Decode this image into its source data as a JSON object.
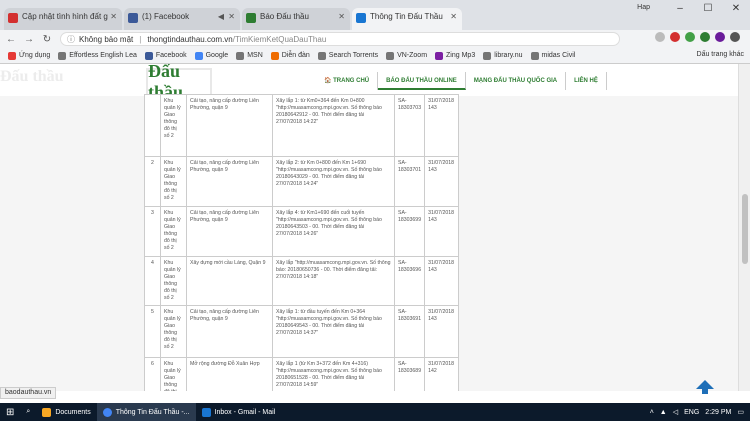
{
  "browser": {
    "tabs": [
      {
        "title": "Cập nhật tình hình đất g",
        "color": "#d32f2f"
      },
      {
        "title": "(1) Facebook",
        "color": "#3b5998"
      },
      {
        "title": "Báo Đấu thầu",
        "color": "#2e7d32"
      },
      {
        "title": "Thông Tin Đấu Thầu",
        "color": "#1976d2"
      }
    ],
    "user_tag": "Hap",
    "address": {
      "secure_label": "Không bảo mật",
      "url": "thongtindauthau.com.vn",
      "path": "/TimKiemKetQuaDauThau"
    },
    "bookmarks": [
      {
        "label": "Ứng dụng",
        "color": "#e53935"
      },
      {
        "label": "Effortless English Lea",
        "color": "#757575"
      },
      {
        "label": "Facebook",
        "color": "#3b5998"
      },
      {
        "label": "Google",
        "color": "#4285f4"
      },
      {
        "label": "MSN",
        "color": "#757575"
      },
      {
        "label": "Diễn đàn",
        "color": "#ef6c00"
      },
      {
        "label": "Search Torrents",
        "color": "#757575"
      },
      {
        "label": "VN-Zoom",
        "color": "#757575"
      },
      {
        "label": "Zing Mp3",
        "color": "#7b1fa2"
      },
      {
        "label": "library.nu",
        "color": "#757575"
      },
      {
        "label": "midas Civil",
        "color": "#757575"
      }
    ],
    "bookmarks_other": "Dấu trang khác"
  },
  "site": {
    "logo": "Đấu thầu",
    "logo_bg": "Đấu thầu",
    "nav": [
      "TRANG CHỦ",
      "BÁO ĐẤU THẦU ONLINE",
      "MẠNG ĐẤU THẦU QUỐC GIA",
      "LIÊN HỆ"
    ],
    "rows": [
      {
        "stt": "",
        "owner": "Khu quản lý Giao thông đô thị số 2",
        "name": "Cải tạo, nâng cấp đường Liên Phường, quận 9",
        "desc": "Xây lắp 1: từ Km0+364 đến Km 0+800 \"http://muasamcong.mpi.gov.vn. Số thông báo 20180642912 - 00. Thời điểm đăng tải 27/07/2018 14:22\"",
        "code": "SA-18303703",
        "date": "31/07/2018 143"
      },
      {
        "stt": "2",
        "owner": "Khu quản lý Giao thông đô thị số 2",
        "name": "Cải tạo, nâng cấp đường Liên Phường, quận 9",
        "desc": "Xây lắp 2: từ Km 0+800 đến Km 1+690 \"http://muasamcong.mpi.gov.vn. Số thông báo 20180643029 - 00. Thời điểm đăng tải 27/07/2018 14:24\"",
        "code": "SA-18303701",
        "date": "31/07/2018 143"
      },
      {
        "stt": "3",
        "owner": "Khu quản lý Giao thông đô thị số 2",
        "name": "Cải tạo, nâng cấp đường Liên Phường, quận 9",
        "desc": "Xây lắp 4: từ Km1+690 đến cuối tuyến \"http://muasamcong.mpi.gov.vn. Số thông báo 20180643503 - 00. Thời điểm đăng tải 27/07/2018 14:26\"",
        "code": "SA-18303699",
        "date": "31/07/2018 143"
      },
      {
        "stt": "4",
        "owner": "Khu quản lý Giao thông đô thị số 2",
        "name": "Xây dựng mới cầu Láng, Quận 9",
        "desc": "Xây lắp \"http://muasamcong.mpi.gov.vn. Số thông báo: 20180650736 - 00. Thời điểm đăng tải: 27/07/2018 14:18\"",
        "code": "SA-18303696",
        "date": "31/07/2018 143"
      },
      {
        "stt": "5",
        "owner": "Khu quản lý Giao thông đô thị số 2",
        "name": "Cải tạo, nâng cấp đường Liên Phường, quận 9",
        "desc": "Xây lắp 1: từ đầu tuyến đến Km 0+364 \"http://muasamcong.mpi.gov.vn. Số thông báo 20180649543 - 00. Thời điểm đăng tải 27/07/2018 14:37\"",
        "code": "SA-18303691",
        "date": "31/07/2018 143"
      },
      {
        "stt": "6",
        "owner": "Khu quản lý Giao thông đô thị",
        "name": "Mở rộng đường Đỗ Xuân Hợp",
        "desc": "Xây lắp 1 (từ Km 3+372 đến Km 4+316) \"http://muasamcong.mpi.gov.vn. Số thông báo 20180651528 - 00. Thời điểm đăng tải 27/07/2018 14:59\"",
        "code": "SA-18303689",
        "date": "31/07/2018 142"
      }
    ]
  },
  "status_link": "baodauthau.vn",
  "taskbar": {
    "items": [
      {
        "label": "Documents",
        "color": "#f9a825"
      },
      {
        "label": "Thông Tin Đấu Thầu -...",
        "color": "#4285f4"
      },
      {
        "label": "Inbox - Gmail - Mail",
        "color": "#1976d2"
      }
    ],
    "lang": "ENG",
    "time": "2:29 PM"
  }
}
